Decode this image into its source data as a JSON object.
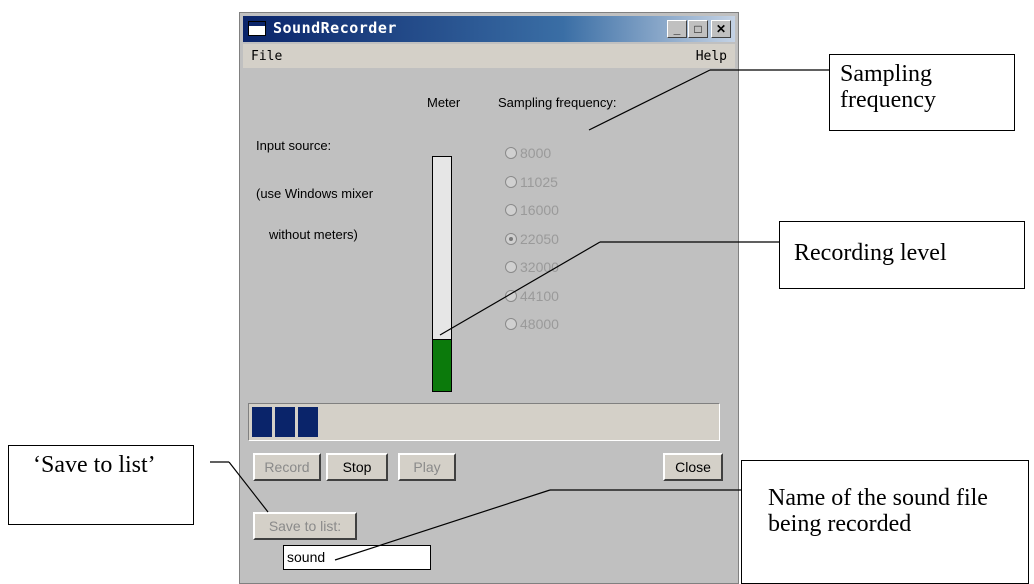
{
  "window": {
    "title": "SoundRecorder",
    "min_symbol": "_",
    "max_symbol": "□",
    "close_symbol": "✕"
  },
  "menu": {
    "file": "File",
    "help": "Help"
  },
  "labels": {
    "meter": "Meter",
    "sampling_frequency": "Sampling frequency:",
    "input_source": "Input source:",
    "use_mixer": "(use Windows mixer",
    "without_meters": "without meters)"
  },
  "sampling_rates": [
    {
      "label": "8000",
      "selected": false
    },
    {
      "label": "11025",
      "selected": false
    },
    {
      "label": "16000",
      "selected": false
    },
    {
      "label": "22050",
      "selected": true
    },
    {
      "label": "32000",
      "selected": false
    },
    {
      "label": "44100",
      "selected": false
    },
    {
      "label": "48000",
      "selected": false
    }
  ],
  "meter_level": 0.22,
  "buttons": {
    "record": "Record",
    "stop": "Stop",
    "play": "Play",
    "close": "Close",
    "save_to_list": "Save to list:"
  },
  "file_name": "sound",
  "callouts": {
    "sampling": "Sampling frequency",
    "recording_level": "Recording level",
    "save_to_list": "‘Save to list’",
    "file_name": "Name of the sound file being recorded"
  },
  "colors": {
    "titlebar": "#0a246a",
    "meter_fill": "#0b7a0b",
    "progress_block": "#0a246a"
  }
}
